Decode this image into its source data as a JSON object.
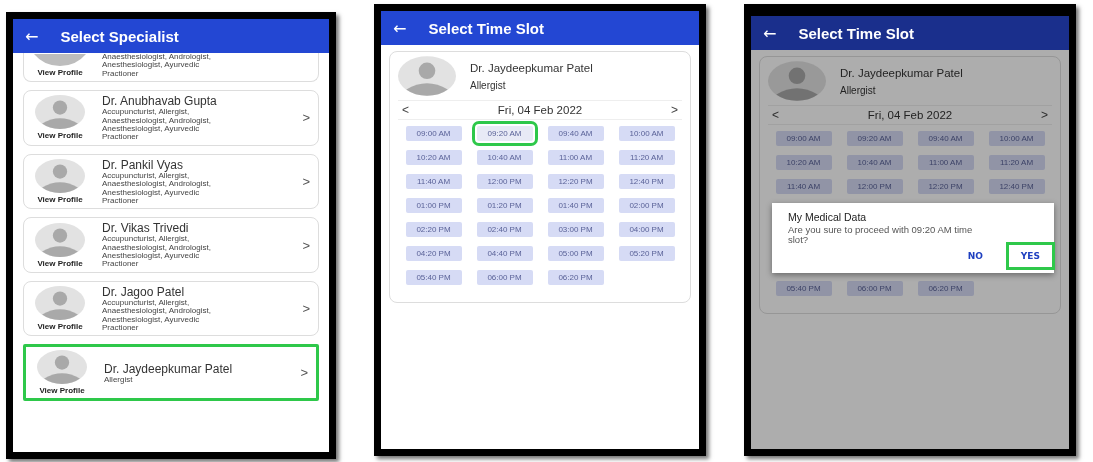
{
  "screens": [
    {
      "kind": "specialists",
      "title": "Select Specialist",
      "back_icon": "←",
      "doctors": [
        {
          "cut": true,
          "specialties": "Anaesthesiologist, Andrologist, Anesthesiologist, Ayurvedic Practioner",
          "link": "View Profile",
          "highlighted": false
        },
        {
          "cut": false,
          "name": "Dr. Anubhavab Gupta",
          "specialties": "Accupuncturist, Allergist, Anaesthesiologist, Andrologist, Anesthesiologist, Ayurvedic Practioner",
          "link": "View Profile",
          "chevron": ">",
          "highlighted": false
        },
        {
          "cut": false,
          "name": "Dr. Pankil Vyas",
          "specialties": "Accupuncturist, Allergist, Anaesthesiologist, Andrologist, Anesthesiologist, Ayurvedic Practioner",
          "link": "View Profile",
          "chevron": ">",
          "highlighted": false
        },
        {
          "cut": false,
          "name": "Dr. Vikas Trivedi",
          "specialties": "Accupuncturist, Allergist, Anaesthesiologist, Andrologist, Anesthesiologist, Ayurvedic Practioner",
          "link": "View Profile",
          "chevron": ">",
          "highlighted": false
        },
        {
          "cut": false,
          "name": "Dr. Jagoo Patel",
          "specialties": "Accupuncturist, Allergist, Anaesthesiologist, Andrologist, Anesthesiologist, Ayurvedic Practioner",
          "link": "View Profile",
          "chevron": ">",
          "highlighted": false
        },
        {
          "cut": false,
          "name": "Dr. Jaydeepkumar Patel",
          "specialties": "Allergist",
          "link": "View Profile",
          "chevron": ">",
          "highlighted": true
        }
      ]
    },
    {
      "kind": "slots",
      "title": "Select Time Slot",
      "back_icon": "←",
      "dimmed": false,
      "doctor": {
        "name": "Dr. Jaydeepkumar Patel",
        "specialty": "Allergist"
      },
      "date": {
        "prev": "<",
        "label": "Fri, 04 Feb 2022",
        "next": ">"
      },
      "slots": [
        {
          "time": "09:00 AM",
          "selected": false
        },
        {
          "time": "09:20 AM",
          "selected": true
        },
        {
          "time": "09:40 AM",
          "selected": false
        },
        {
          "time": "10:00 AM",
          "selected": false
        },
        {
          "time": "10:20 AM",
          "selected": false
        },
        {
          "time": "10:40 AM",
          "selected": false
        },
        {
          "time": "11:00 AM",
          "selected": false
        },
        {
          "time": "11:20 AM",
          "selected": false
        },
        {
          "time": "11:40 AM",
          "selected": false
        },
        {
          "time": "12:00 PM",
          "selected": false
        },
        {
          "time": "12:20 PM",
          "selected": false
        },
        {
          "time": "12:40 PM",
          "selected": false
        },
        {
          "time": "01:00 PM",
          "selected": false
        },
        {
          "time": "01:20 PM",
          "selected": false
        },
        {
          "time": "01:40 PM",
          "selected": false
        },
        {
          "time": "02:00 PM",
          "selected": false
        },
        {
          "time": "02:20 PM",
          "selected": false
        },
        {
          "time": "02:40 PM",
          "selected": false
        },
        {
          "time": "03:00 PM",
          "selected": false
        },
        {
          "time": "04:00 PM",
          "selected": false
        },
        {
          "time": "04:20 PM",
          "selected": false
        },
        {
          "time": "04:40 PM",
          "selected": false
        },
        {
          "time": "05:00 PM",
          "selected": false
        },
        {
          "time": "05:20 PM",
          "selected": false
        },
        {
          "time": "05:40 PM",
          "selected": false
        },
        {
          "time": "06:00 PM",
          "selected": false
        },
        {
          "time": "06:20 PM",
          "selected": false
        }
      ]
    },
    {
      "kind": "slots",
      "title": "Select Time Slot",
      "back_icon": "←",
      "dimmed": true,
      "doctor": {
        "name": "Dr. Jaydeepkumar Patel",
        "specialty": "Allergist"
      },
      "date": {
        "prev": "<",
        "label": "Fri, 04 Feb 2022",
        "next": ">"
      },
      "slots": [
        {
          "time": "09:00 AM",
          "selected": false
        },
        {
          "time": "09:20 AM",
          "selected": false
        },
        {
          "time": "09:40 AM",
          "selected": false
        },
        {
          "time": "10:00 AM",
          "selected": false
        },
        {
          "time": "10:20 AM",
          "selected": false
        },
        {
          "time": "10:40 AM",
          "selected": false
        },
        {
          "time": "11:00 AM",
          "selected": false
        },
        {
          "time": "11:20 AM",
          "selected": false
        },
        {
          "time": "11:40 AM",
          "selected": false
        },
        {
          "time": "12:00 PM",
          "selected": false
        },
        {
          "time": "12:20 PM",
          "selected": false
        },
        {
          "time": "12:40 PM",
          "selected": false
        }
      ],
      "dialog": {
        "title": "My Medical Data",
        "message": "Are you sure to proceed with 09:20 AM time slot?",
        "buttons": [
          {
            "label": "NO",
            "highlighted": false
          },
          {
            "label": "YES",
            "highlighted": true
          }
        ]
      },
      "slots_below_dialog": [
        {
          "time": "05:40 PM",
          "selected": false
        },
        {
          "time": "06:00 PM",
          "selected": false
        },
        {
          "time": "06:20 PM",
          "selected": false
        }
      ]
    }
  ]
}
